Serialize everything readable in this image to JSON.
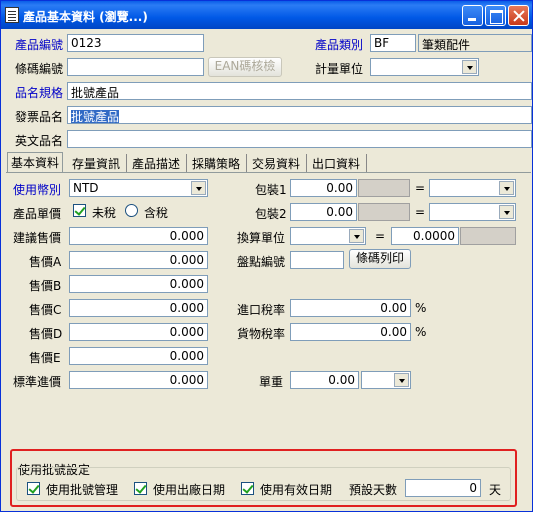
{
  "window": {
    "title": "產品基本資料 (瀏覽...)"
  },
  "header": {
    "product_code": {
      "label": "產品編號",
      "value": "0123"
    },
    "product_category": {
      "label": "產品類別",
      "code": "BF",
      "name": "筆類配件"
    },
    "barcode": {
      "label": "條碼編號",
      "value": "",
      "button": "EAN碼核檢"
    },
    "unit": {
      "label": "計量單位",
      "value": ""
    },
    "spec": {
      "label": "品名規格",
      "value": "批號產品"
    },
    "invoice_name": {
      "label": "發票品名",
      "value": "批號產品"
    },
    "english_name": {
      "label": "英文品名",
      "value": ""
    }
  },
  "tabs": [
    "基本資料",
    "存量資訊",
    "產品描述",
    "採購策略",
    "交易資料",
    "出口資料"
  ],
  "basic": {
    "currency": {
      "label": "使用幣別",
      "value": "NTD"
    },
    "tax": {
      "label": "產品單價",
      "option_excl": "未稅",
      "option_incl": "含稅",
      "selected": "未稅"
    },
    "suggested_price": {
      "label": "建議售價",
      "value": "0.000"
    },
    "price_a": {
      "label": "售價A",
      "value": "0.000"
    },
    "price_b": {
      "label": "售價B",
      "value": "0.000"
    },
    "price_c": {
      "label": "售價C",
      "value": "0.000"
    },
    "price_d": {
      "label": "售價D",
      "value": "0.000"
    },
    "price_e": {
      "label": "售價E",
      "value": "0.000"
    },
    "std_cost": {
      "label": "標準進價",
      "value": "0.000"
    },
    "pack1": {
      "label": "包裝1",
      "value": "0.00",
      "eq": "="
    },
    "pack2": {
      "label": "包裝2",
      "value": "0.00",
      "eq": "="
    },
    "conv_unit": {
      "label": "換算單位",
      "eq": "=",
      "value": "0.0000"
    },
    "inventory_code": {
      "label": "盤點編號",
      "value": "",
      "button": "條碼列印"
    },
    "import_tax": {
      "label": "進口稅率",
      "value": "0.00",
      "unit": "%"
    },
    "goods_tax": {
      "label": "貨物稅率",
      "value": "0.00",
      "unit": "%"
    },
    "unit_weight": {
      "label": "單重",
      "value": "0.00"
    }
  },
  "batch": {
    "title": "使用批號設定",
    "use_batch": {
      "label": "使用批號管理",
      "checked": true
    },
    "use_mfg_date": {
      "label": "使用出廠日期",
      "checked": true
    },
    "use_exp_date": {
      "label": "使用有效日期",
      "checked": true
    },
    "default_days": {
      "label": "預設天數",
      "value": "0",
      "unit": "天"
    }
  }
}
